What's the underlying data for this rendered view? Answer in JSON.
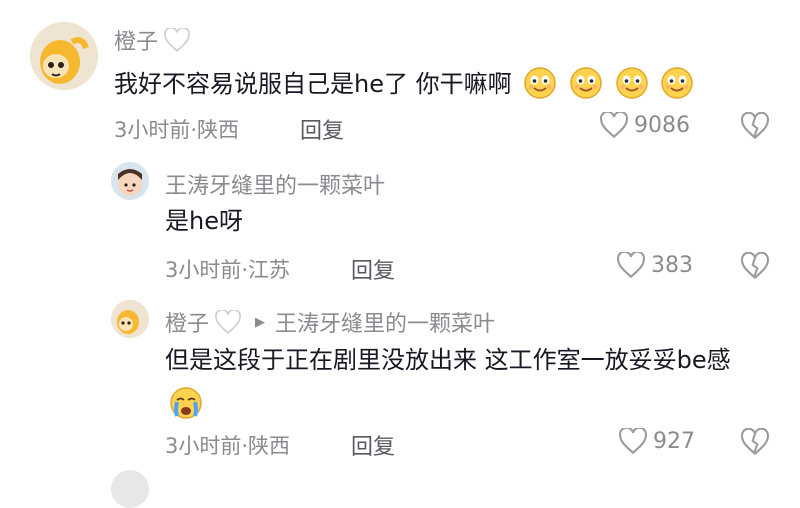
{
  "comments": [
    {
      "username": "橙子",
      "text": "我好不容易说服自己是he了  你干嘛啊",
      "meta": "3小时前·陕西",
      "reply_label": "回复",
      "likes": "9086",
      "emoji_count": 4
    },
    {
      "username": "王涛牙缝里的一颗菜叶",
      "text": "是he呀",
      "meta": "3小时前·江苏",
      "reply_label": "回复",
      "likes": "383"
    },
    {
      "username": "橙子",
      "reply_to": "王涛牙缝里的一颗菜叶",
      "text": "但是这段于正在剧里没放出来  这工作室一放妥妥be感",
      "meta": "3小时前·陕西",
      "reply_label": "回复",
      "likes": "927"
    }
  ],
  "icons": {
    "like": "heart-outline-icon",
    "dislike": "broken-heart-icon",
    "user_badge": "white-heart-icon",
    "reply_arrow": "play-triangle-icon",
    "emoji_smile": "smiling-face-emoji",
    "emoji_cry": "crying-face-emoji"
  },
  "colors": {
    "secondary_text": "#8a8b91",
    "primary_text": "#161823",
    "reply_text": "#575a60"
  }
}
